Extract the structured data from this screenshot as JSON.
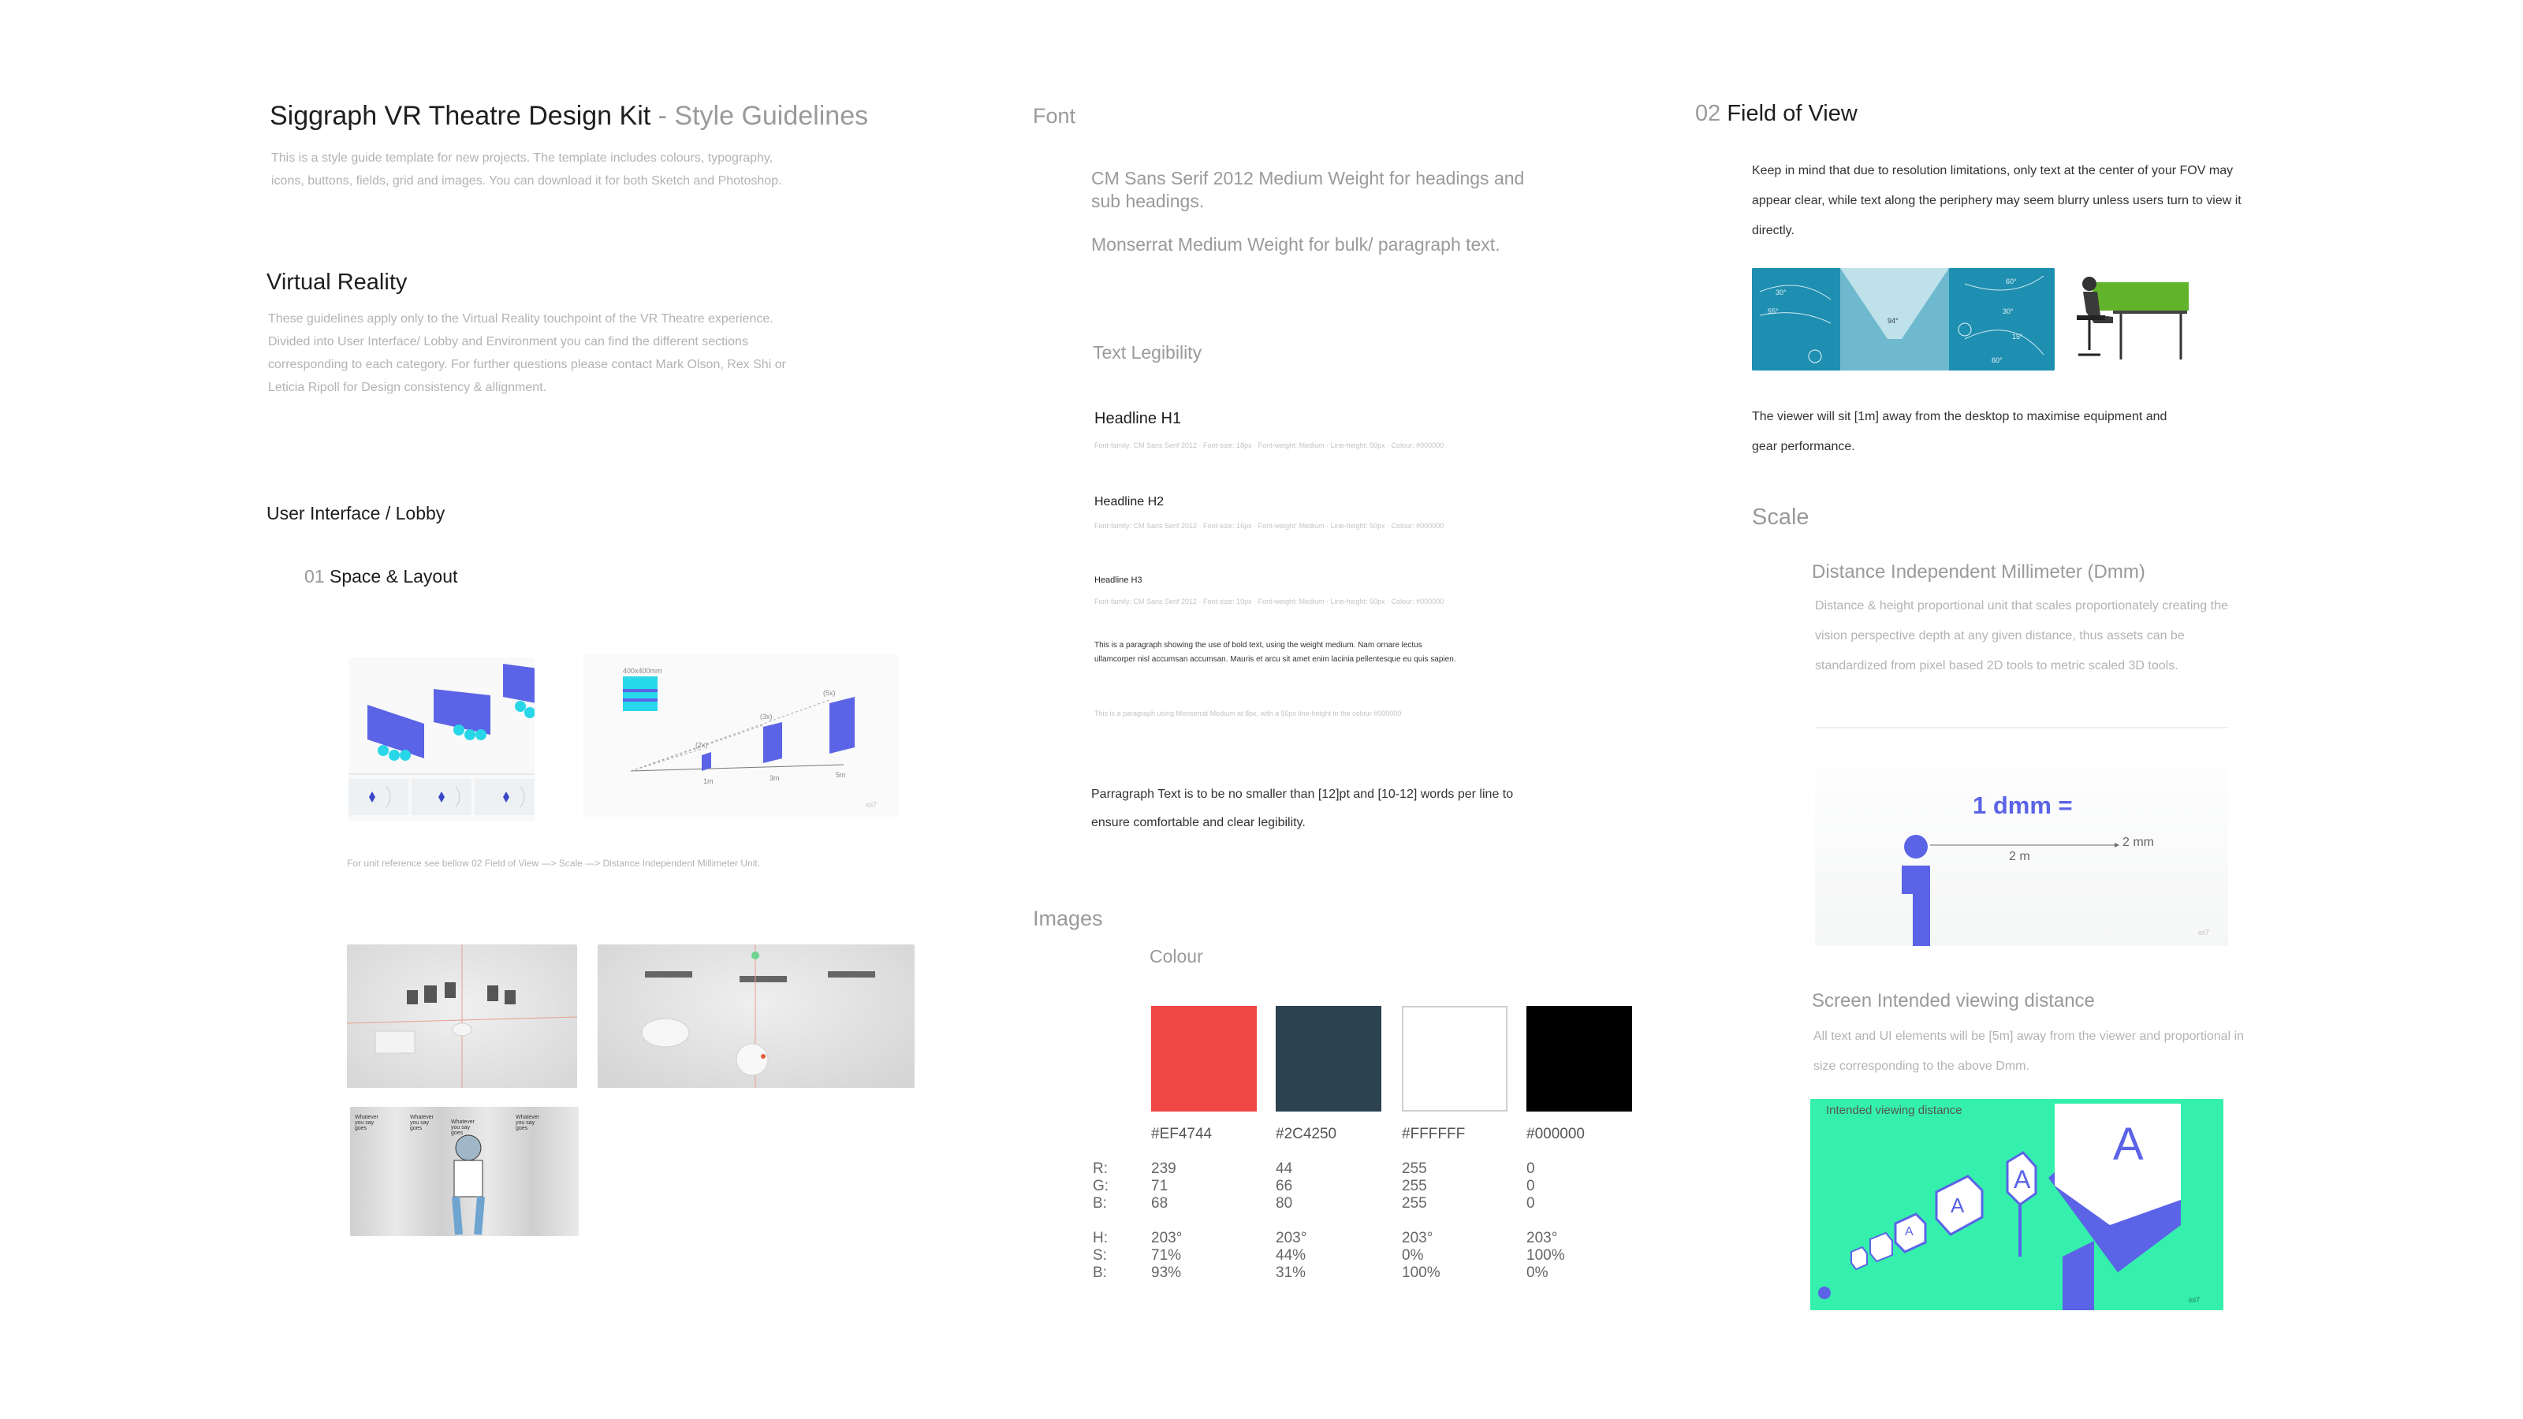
{
  "left": {
    "title_main": "Siggraph VR Theatre Design Kit",
    "title_sep": " - ",
    "title_sub": "Style Guidelines",
    "intro": "This is a style guide template for new projects. The template includes colours, typography, icons, buttons, fields, grid and images. You can download it for both Sketch and Photoshop.",
    "vr_heading": "Virtual Reality",
    "vr_text": "These guidelines apply only to the Virtual Reality touchpoint of the VR Theatre experience. Divided into User Interface/ Lobby and Environment you can find the different sections corresponding to each category. For further questions please contact Mark Olson, Rex Shi or Leticia Ripoll for Design consistency & allignment.",
    "ui_heading": "User Interface / Lobby",
    "space_num": "01",
    "space_label": "Space & Layout",
    "unit_ref": "For unit reference see bellow 02 Field of View —> Scale —> Distance Independent Millimeter Unit.",
    "sketch_labels": [
      "Whatever you say goes",
      "Whatever you say goes",
      "Whatever you say goes",
      "Whatever you say goes"
    ],
    "iso_tags": [
      "(2x)",
      "(3x)",
      "(5x)"
    ],
    "iso_axis": [
      "1m",
      "3m",
      "5m"
    ],
    "iso_size": "400x400mm",
    "watermark": "ioi7"
  },
  "middle": {
    "font_heading": "Font",
    "font_line1": "CM Sans Serif 2012 Medium Weight for headings and sub headings.",
    "font_line2": "Monserrat Medium Weight for bulk/ paragraph text.",
    "legibility_heading": "Text Legibility",
    "h1": "Headline H1",
    "h1_spec": "Font-family: CM Sans Serif 2012  ·  Font-size: 18px  ·  Font-weight: Medium  ·  Line-height: 50px  ·  Colour: #000000",
    "h2": "Headline H2",
    "h2_spec": "Font-family: CM Sans Serif 2012  ·  Font-size: 16px  ·  Font-weight: Medium  ·  Line-height: 50px  ·  Colour: #000000",
    "h3": "Headline H3",
    "h3_spec": "Font-family: CM Sans Serif 2012  ·  Font-size: 10px  ·  Font-weight: Medium  ·  Line-height: 50px  ·  Colour: #000000",
    "bold_para": "This is a paragraph showing the use of bold text, using the weight medium. Nam ornare lectus ullamcorper nisl accumsan accumsan. Mauris et arcu sit amet enim lacinia pellentesque eu quis sapien.",
    "light_para": "This is a paragraph using Monserrat Medium at 8px, with a 50px line-height in the colour #000000",
    "legibility_note": "Parragraph Text is to be no smaller than [12]pt and [10-12] words per line to ensure comfortable and clear legibility.",
    "images_heading": "Images",
    "colour_heading": "Colour",
    "row_labels_rgb": [
      "R:",
      "G:",
      "B:"
    ],
    "row_labels_hsb": [
      "H:",
      "S:",
      "B:"
    ],
    "colours": [
      {
        "hex": "#EF4744",
        "swatch": "#EF4744",
        "rgb": [
          "239",
          "71",
          "68"
        ],
        "hsb": [
          "203°",
          "71%",
          "93%"
        ]
      },
      {
        "hex": "#2C4250",
        "swatch": "#2C4250",
        "rgb": [
          "44",
          "66",
          "80"
        ],
        "hsb": [
          "203°",
          "44%",
          "31%"
        ]
      },
      {
        "hex": "#FFFFFF",
        "swatch": "#FFFFFF",
        "rgb": [
          "255",
          "255",
          "255"
        ],
        "hsb": [
          "203°",
          "0%",
          "100%"
        ]
      },
      {
        "hex": "#000000",
        "swatch": "#000000",
        "rgb": [
          "0",
          "0",
          "0"
        ],
        "hsb": [
          "203°",
          "100%",
          "0%"
        ]
      }
    ]
  },
  "right": {
    "fov_num": "02",
    "fov_label": "Field of View",
    "fov_text": "Keep in mind that due to resolution limitations, only text at the center of your FOV may appear clear, while text along the periphery may seem blurry unless users turn to view it directly.",
    "fov_angles": [
      "30°",
      "55°",
      "94°",
      "60°",
      "30°",
      "15°",
      "60°"
    ],
    "viewer_text": "The viewer will sit [1m] away from the desktop to maximise equipment and gear performance.",
    "scale_heading": "Scale",
    "dmm_heading": "Distance Independent Millimeter (Dmm)",
    "dmm_text": "Distance & height proportional unit that scales proportionately creating the vision perspective depth at any given distance, thus assets can be standardized from pixel based 2D tools to metric scaled 3D tools.",
    "dmm_big": "1 dmm =",
    "dmm_2m": "2 m",
    "dmm_2mm": "2 mm",
    "screen_heading": "Screen Intended viewing distance",
    "screen_text": "All text and UI elements will be [5m] away from the viewer and proportional in size corresponding to the above Dmm.",
    "iso_label": "Intended viewing distance",
    "iso_letter": "A",
    "watermark": "ioi7"
  },
  "colors": {
    "accent_blue": "#5b63e6",
    "fov_teal": "#1f8fb1",
    "green_bar": "#62b32c",
    "iso_green": "#35f0ad"
  }
}
